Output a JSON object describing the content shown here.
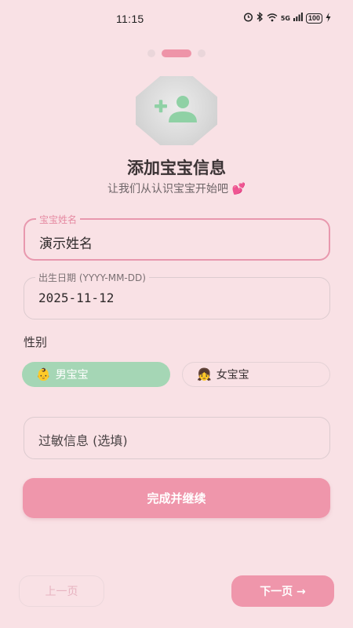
{
  "status_bar": {
    "time": "11:15",
    "network": "5G",
    "battery": "100"
  },
  "pager": {
    "total_steps": 3,
    "current_step": 2
  },
  "header": {
    "avatar_icon": "add-person-icon",
    "title": "添加宝宝信息",
    "subtitle": "让我们从认识宝宝开始吧 💕"
  },
  "form": {
    "name": {
      "label": "宝宝姓名",
      "value": "演示姓名"
    },
    "birthdate": {
      "label": "出生日期 (YYYY-MM-DD)",
      "value": "2025-11-12"
    },
    "gender": {
      "label": "性别",
      "options": [
        {
          "emoji": "👶",
          "label": "男宝宝",
          "selected": true
        },
        {
          "emoji": "👧",
          "label": "女宝宝",
          "selected": false
        }
      ]
    },
    "allergy": {
      "placeholder": "过敏信息 (选填)"
    },
    "submit_label": "完成并继续"
  },
  "nav": {
    "prev_label": "上一页",
    "next_label": "下一页 →"
  },
  "colors": {
    "background": "#f9e1e5",
    "accent_pink": "#ef96ab",
    "selected_green": "#a5d6b5",
    "avatar_icon_green": "#8fd1a5"
  }
}
